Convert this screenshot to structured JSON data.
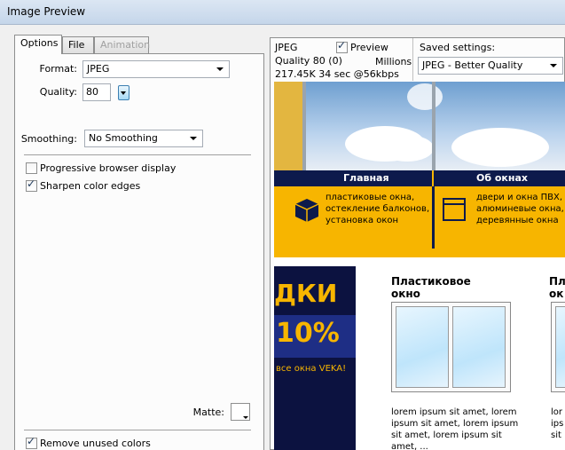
{
  "window": {
    "title": "Image Preview"
  },
  "tabs": [
    {
      "label": "Options",
      "active": true,
      "enabled": true
    },
    {
      "label": "File",
      "active": false,
      "enabled": true
    },
    {
      "label": "Animation",
      "active": false,
      "enabled": false
    }
  ],
  "options": {
    "format_label": "Format:",
    "format_value": "JPEG",
    "quality_label": "Quality:",
    "quality_value": "80",
    "smoothing_label": "Smoothing:",
    "smoothing_value": "No Smoothing",
    "progressive_label": "Progressive browser display",
    "progressive_checked": false,
    "sharpen_label": "Sharpen color edges",
    "sharpen_checked": true,
    "matte_label": "Matte:",
    "matte_color": "#ffffff",
    "remove_unused_label": "Remove unused colors",
    "remove_unused_checked": true
  },
  "preview_info": {
    "format": "JPEG",
    "quality": "Quality 80 (0)",
    "size_time": "217.45K  34 sec @56kbps",
    "preview_label": "Preview",
    "preview_checked": true,
    "colors": "Millions",
    "saved_settings_label": "Saved settings:",
    "saved_settings_value": "JPEG - Better Quality"
  },
  "preview_image": {
    "nav_items": [
      "Главная",
      "Об окнах"
    ],
    "feature_1": [
      "пластиковые окна,",
      "остекление балконов,",
      "установка окон"
    ],
    "feature_2": [
      "двери и окна ПВХ,",
      "алюминевые окна,",
      "деревянные окна"
    ],
    "promo_heading": "ДКИ",
    "promo_percent": "10%",
    "promo_sub": "все окна VEKA!",
    "column_1_title": [
      "Пластиковое",
      "окно"
    ],
    "column_2_title": [
      "Пл",
      "ок"
    ],
    "lorem_lines": [
      "lorem ipsum sit amet, lorem",
      "ipsum sit amet, lorem ipsum",
      "sit amet, lorem ipsum sit",
      "amet, ..."
    ],
    "lorem_lines_2": [
      "lor",
      "ips",
      "sit"
    ]
  },
  "colors": {
    "accent_yellow": "#f7b500",
    "nav_navy": "#0d1a4c"
  }
}
